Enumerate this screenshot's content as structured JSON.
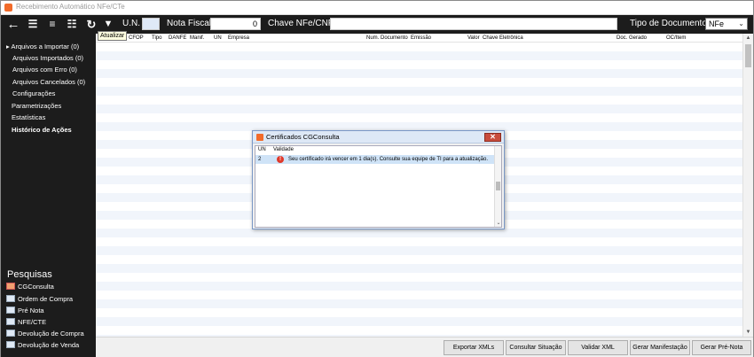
{
  "window": {
    "title": "Recebimento Automático NFe/CTe"
  },
  "toolbar": {
    "un_label": "U.N.",
    "un_value": "",
    "nota_label": "Nota Fiscal",
    "nota_value": "0",
    "chave_label": "Chave NFe/CNPJ",
    "chave_value": "",
    "tipo_label": "Tipo de Documento",
    "tipo_value": "NFe",
    "tooltip": "Atualizar"
  },
  "sidebar": {
    "items": [
      {
        "label": "Arquivos a Importar (0)"
      },
      {
        "label": "Arquivos Importados (0)"
      },
      {
        "label": "Arquivos com Erro (0)"
      },
      {
        "label": "Arquivos Cancelados (0)"
      },
      {
        "label": "Configurações"
      },
      {
        "label": "Parametrizações"
      },
      {
        "label": "Estatísticas"
      },
      {
        "label": "Histórico de Ações"
      }
    ],
    "pesquisas_title": "Pesquisas",
    "pesquisas": [
      {
        "label": "CGConsulta",
        "icon": "cgconsulta-icon"
      },
      {
        "label": "Ordem de Compra",
        "icon": "window-icon"
      },
      {
        "label": "Pré Nota",
        "icon": "window-icon"
      },
      {
        "label": "NFE/CTE",
        "icon": "window-icon"
      },
      {
        "label": "Devolução de Compra",
        "icon": "window-icon"
      },
      {
        "label": "Devolução de Venda",
        "icon": "window-icon"
      }
    ]
  },
  "grid": {
    "columns": [
      "CFOP",
      "Tipo",
      "DANFE",
      "Manif.",
      "UN",
      "Empresa",
      "Num. Documento",
      "Emissão",
      "Valor",
      "Chave Eletrônica",
      "Doc. Gerado",
      "OC/Item"
    ]
  },
  "buttons": {
    "exportar": "Exportar XMLs",
    "consultar": "Consultar Situação",
    "validar": "Validar XML",
    "manifestacao": "Gerar Manifestação",
    "prenota": "Gerar Pré-Nota"
  },
  "dialog": {
    "title": "Certificados CGConsulta",
    "col_un": "UN",
    "col_validade": "Validade",
    "row_un": "2",
    "row_message": "Seu certificado irá vencer em 1 dia(s). Consulte sua equipe de TI para a atualização."
  },
  "colors": {
    "dark_panel": "#1c1c1c",
    "row_stripe": "#f1f5fb",
    "selected_row": "#cfe3f7"
  }
}
